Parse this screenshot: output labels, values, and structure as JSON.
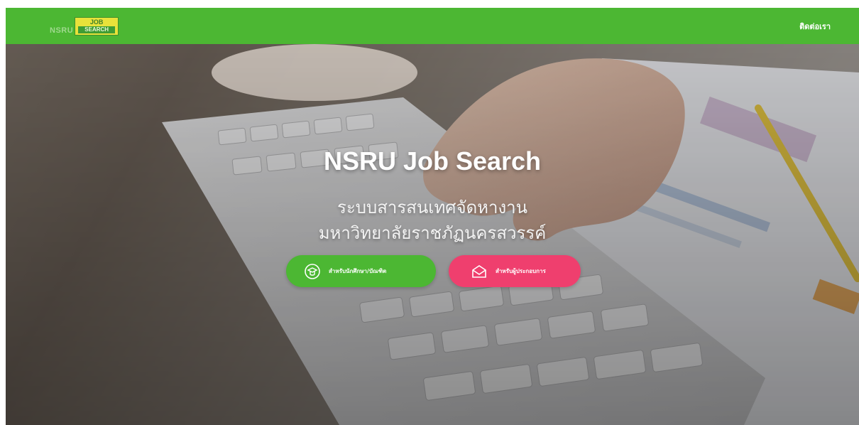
{
  "nav": {
    "brand_top": "JOB",
    "brand_bottom": "SEARCH",
    "brand_prefix": "NSRU",
    "link_label": "ติดต่อเรา"
  },
  "hero": {
    "title": "NSRU Job Search",
    "subtitle_line1": "ระบบสารสนเทศจัดหางาน",
    "subtitle_line2": "มหาวิทยาลัยราชภัฏนครสวรรค์",
    "buttons": [
      {
        "label": "สำหรับนักศึกษา/บัณฑิต",
        "icon": "graduate-icon",
        "color": "#4cb733"
      },
      {
        "label": "สำหรับผู้ประกอบการ",
        "icon": "envelope-icon",
        "color": "#ef3f6e"
      }
    ]
  },
  "colors": {
    "navbar": "#4cb733",
    "primary_button": "#4cb733",
    "secondary_button": "#ef3f6e"
  }
}
